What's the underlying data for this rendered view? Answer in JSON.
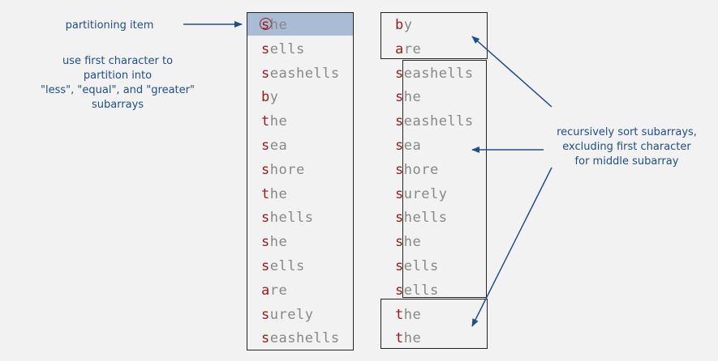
{
  "labels": {
    "partitioning_item": "partitioning item",
    "first_char_note": [
      "use first character to",
      "partition into",
      "\"less\", \"equal\", and \"greater\"",
      "subarrays"
    ],
    "recursive_note": [
      "recursively sort subarrays,",
      "excluding first character",
      "for middle subarray"
    ]
  },
  "left_column": [
    {
      "first": "s",
      "rest": "he"
    },
    {
      "first": "s",
      "rest": "ells"
    },
    {
      "first": "s",
      "rest": "eashells"
    },
    {
      "first": "b",
      "rest": "y"
    },
    {
      "first": "t",
      "rest": "he"
    },
    {
      "first": "s",
      "rest": "ea"
    },
    {
      "first": "s",
      "rest": "hore"
    },
    {
      "first": "t",
      "rest": "he"
    },
    {
      "first": "s",
      "rest": "hells"
    },
    {
      "first": "s",
      "rest": "he"
    },
    {
      "first": "s",
      "rest": "ells"
    },
    {
      "first": "a",
      "rest": "re"
    },
    {
      "first": "s",
      "rest": "urely"
    },
    {
      "first": "s",
      "rest": "eashells"
    }
  ],
  "right_column": [
    {
      "first": "b",
      "rest": "y"
    },
    {
      "first": "a",
      "rest": "re"
    },
    {
      "first": "s",
      "rest": "eashells"
    },
    {
      "first": "s",
      "rest": "he"
    },
    {
      "first": "s",
      "rest": "eashells"
    },
    {
      "first": "s",
      "rest": "ea"
    },
    {
      "first": "s",
      "rest": "hore"
    },
    {
      "first": "s",
      "rest": "urely"
    },
    {
      "first": "s",
      "rest": "hells"
    },
    {
      "first": "s",
      "rest": "he"
    },
    {
      "first": "s",
      "rest": "ells"
    },
    {
      "first": "s",
      "rest": "ells"
    },
    {
      "first": "t",
      "rest": "he"
    },
    {
      "first": "t",
      "rest": "he"
    }
  ],
  "colors": {
    "accent": "#1f4e8c",
    "first_char": "#9b1b1b",
    "word_rest": "#888888",
    "highlight": "#a9bcd6",
    "background": "#f2f2f2"
  }
}
